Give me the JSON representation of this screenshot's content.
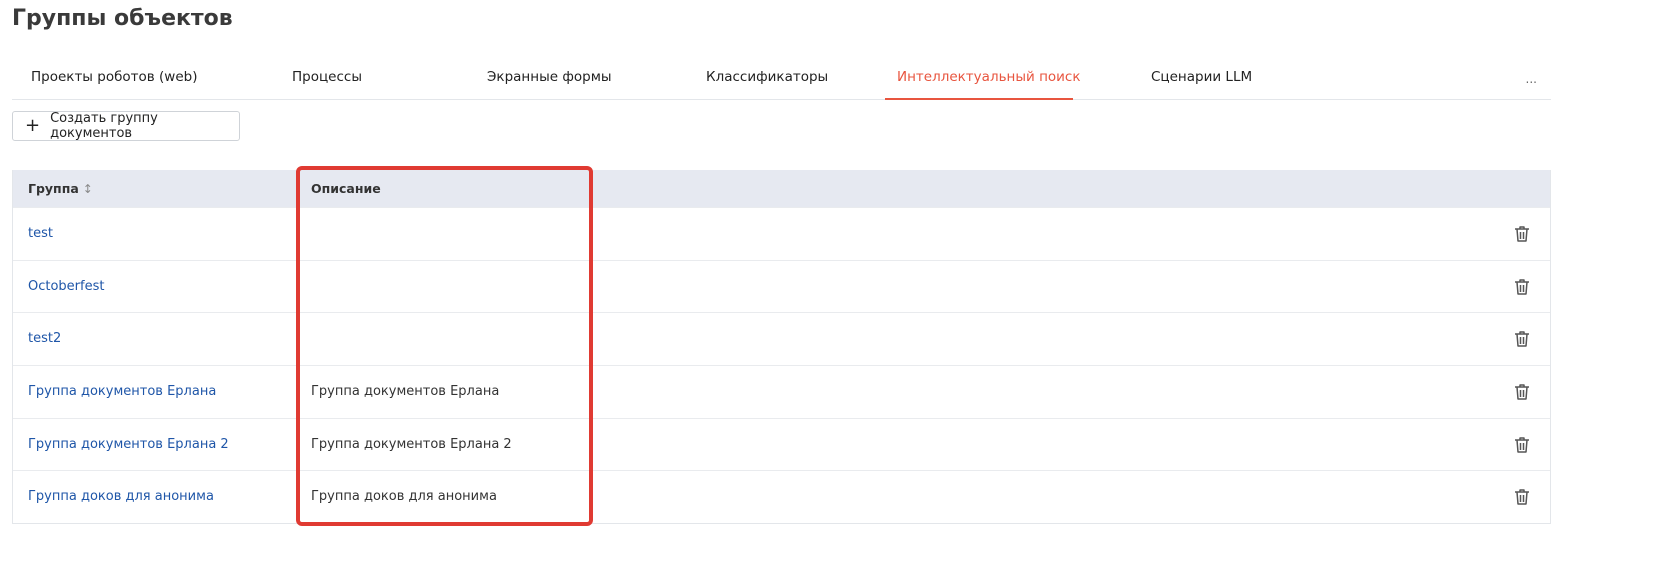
{
  "page": {
    "title": "Группы объектов"
  },
  "tabs": [
    {
      "label": "Проекты роботов (web)",
      "active": false
    },
    {
      "label": "Процессы",
      "active": false
    },
    {
      "label": "Экранные формы",
      "active": false
    },
    {
      "label": "Классификаторы",
      "active": false
    },
    {
      "label": "Интеллектуальный поиск",
      "active": true
    },
    {
      "label": "Сценарии LLM",
      "active": false
    }
  ],
  "tabs_more": "...",
  "toolbar": {
    "create_label": "Создать группу документов"
  },
  "table": {
    "columns": [
      "Группа",
      "Описание"
    ],
    "sort_icon": "↕",
    "rows": [
      {
        "name": "test",
        "description": ""
      },
      {
        "name": "Octoberfest",
        "description": ""
      },
      {
        "name": "test2",
        "description": ""
      },
      {
        "name": "Группа документов Ерлана",
        "description": "Группа документов Ерлана"
      },
      {
        "name": "Группа документов Ерлана 2",
        "description": "Группа документов Ерлана 2"
      },
      {
        "name": "Группа доков для анонима",
        "description": "Группа доков для анонима"
      }
    ]
  },
  "colors": {
    "accent": "#e8553f",
    "link": "#1f56a8",
    "header_bg": "#e6e9f1",
    "highlight": "#e03a32"
  },
  "icons": {
    "create": "plus-icon",
    "sort": "sort-icon",
    "delete": "trash-icon"
  }
}
